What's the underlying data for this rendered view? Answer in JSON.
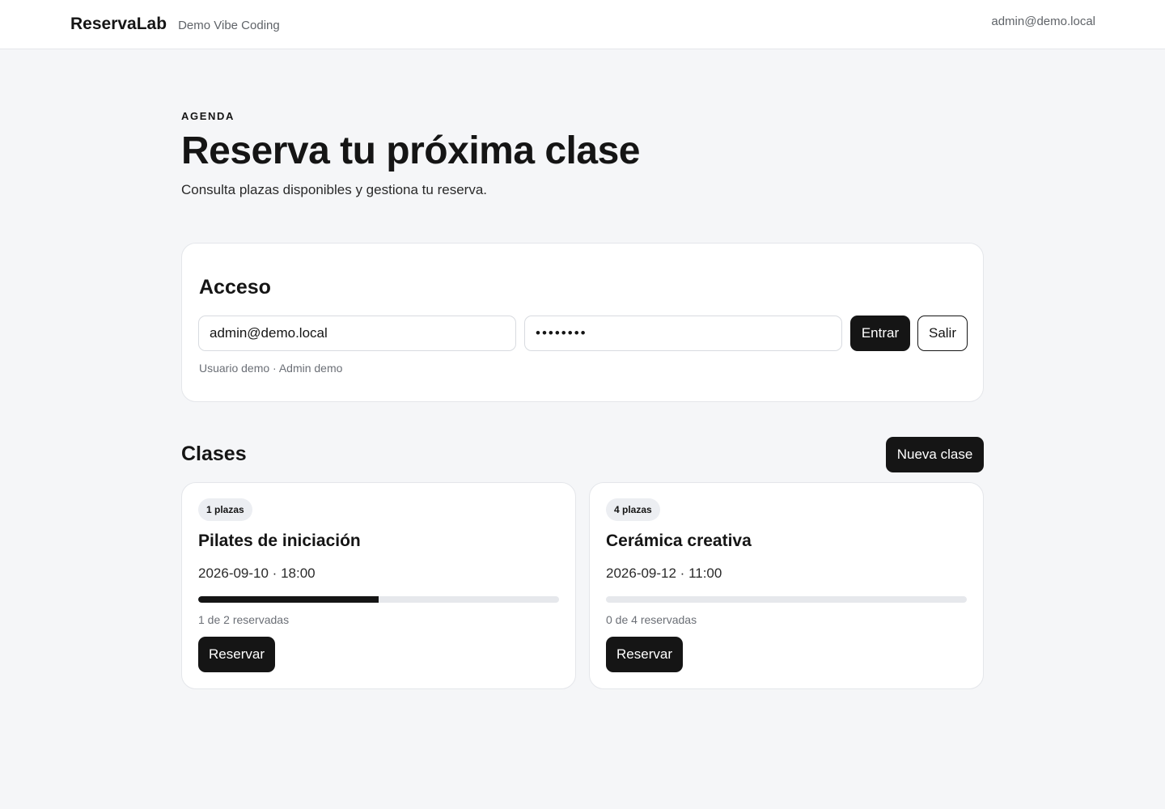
{
  "header": {
    "brand": "ReservaLab",
    "tagline": "Demo Vibe Coding",
    "user_email": "admin@demo.local"
  },
  "hero": {
    "eyebrow": "AGENDA",
    "title": "Reserva tu próxima clase",
    "subtitle": "Consulta plazas disponibles y gestiona tu reserva."
  },
  "access": {
    "title": "Acceso",
    "email_value": "admin@demo.local",
    "password_value": "••••••••",
    "enter_label": "Entrar",
    "exit_label": "Salir",
    "hint": "Usuario demo · Admin demo"
  },
  "classes": {
    "title": "Clases",
    "new_label": "Nueva clase",
    "items": [
      {
        "badge": "1 plazas",
        "name": "Pilates de iniciación",
        "datetime": "2026-09-10 · 18:00",
        "reserved": 1,
        "capacity": 2,
        "count_text": "1 de 2 reservadas",
        "reserve_label": "Reservar"
      },
      {
        "badge": "4 plazas",
        "name": "Cerámica creativa",
        "datetime": "2026-09-12 · 11:00",
        "reserved": 0,
        "capacity": 4,
        "count_text": "0 de 4 reservadas",
        "reserve_label": "Reservar"
      }
    ]
  },
  "colors": {
    "accent": "#151515",
    "background": "#f5f6f8",
    "surface": "#ffffff",
    "muted_text": "#6b6f76"
  }
}
